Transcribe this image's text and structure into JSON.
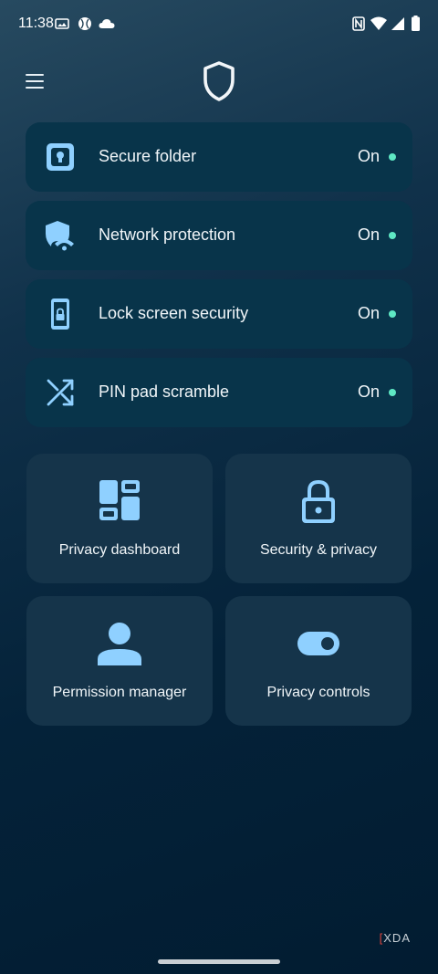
{
  "status_bar": {
    "time": "11:38"
  },
  "colors": {
    "accent": "#8fd0ff",
    "status_on": "#5ee8c4"
  },
  "security_items": [
    {
      "label": "Secure folder",
      "status": "On",
      "icon": "secure-folder-icon"
    },
    {
      "label": "Network protection",
      "status": "On",
      "icon": "network-shield-icon"
    },
    {
      "label": "Lock screen security",
      "status": "On",
      "icon": "phone-lock-icon"
    },
    {
      "label": "PIN pad scramble",
      "status": "On",
      "icon": "shuffle-icon"
    }
  ],
  "tiles": [
    {
      "label": "Privacy dashboard",
      "icon": "dashboard-icon"
    },
    {
      "label": "Security & privacy",
      "icon": "lock-icon"
    },
    {
      "label": "Permission manager",
      "icon": "person-icon"
    },
    {
      "label": "Privacy controls",
      "icon": "toggle-icon"
    }
  ],
  "watermark": {
    "text": "XDA"
  }
}
